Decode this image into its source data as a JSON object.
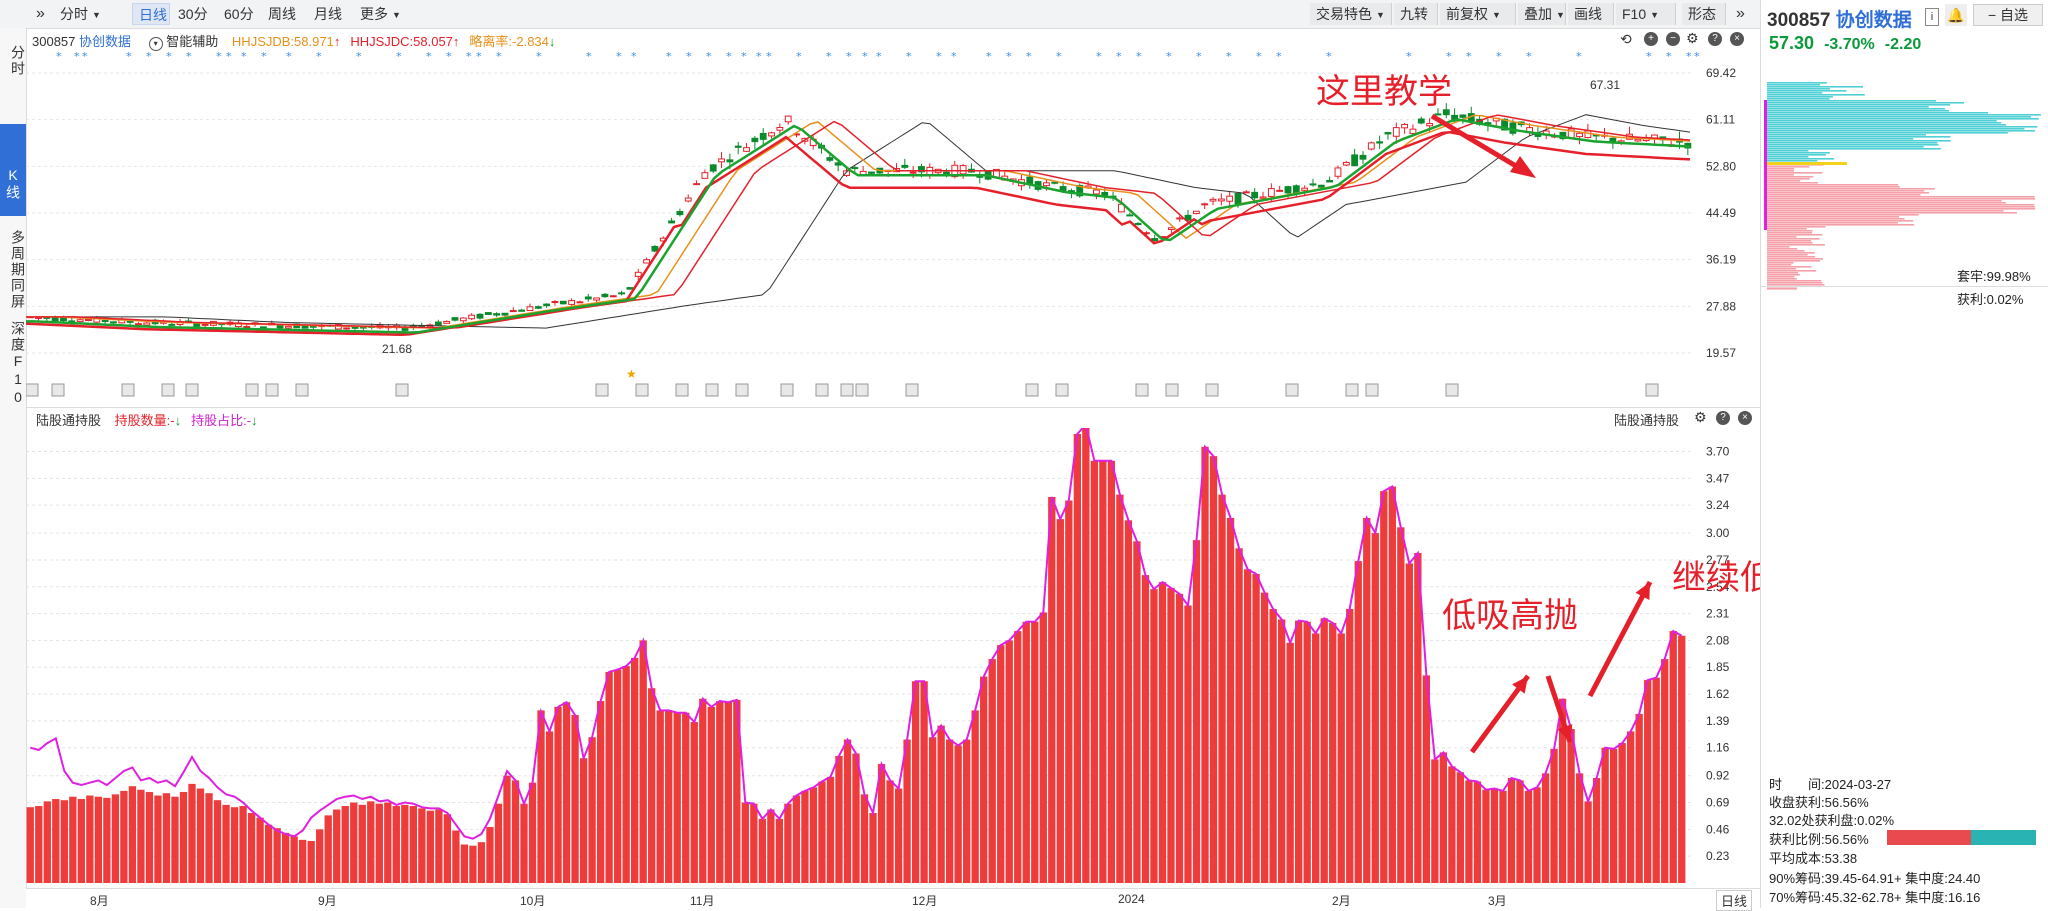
{
  "toolbar": {
    "expand_icon": "double-chevron-right-icon",
    "left_buttons": [
      {
        "label": "分时",
        "caret": true
      },
      {
        "label": "日线",
        "active": true
      },
      {
        "label": "30分"
      },
      {
        "label": "60分"
      },
      {
        "label": "周线"
      },
      {
        "label": "月线"
      },
      {
        "label": "更多",
        "caret": true
      }
    ],
    "right_buttons": [
      {
        "label": "交易特色",
        "caret": true
      },
      {
        "label": "九转"
      },
      {
        "label": "前复权",
        "caret": true
      },
      {
        "label": "叠加",
        "caret": true
      },
      {
        "label": "画线"
      },
      {
        "label": "F10",
        "caret": true
      },
      {
        "label": "形态"
      }
    ]
  },
  "left_nav": [
    {
      "label": "分时"
    },
    {
      "label": "K线",
      "active": true
    },
    {
      "label": "多周期同屏"
    },
    {
      "label": "深度F10"
    }
  ],
  "kline_panel": {
    "code": "300857",
    "name": "协创数据",
    "assist_label": "智能辅助",
    "indicators": [
      {
        "text": "HHJSJDB:58.971",
        "arrow": "↑",
        "color": "#e8901a"
      },
      {
        "text": "HHJSJDC:58.057",
        "arrow": "↑",
        "color": "#e5202a"
      },
      {
        "text": "略离率:-2.834",
        "arrow": "↓",
        "color": "#e8901a"
      }
    ],
    "y_ticks": [
      "69.42",
      "61.11",
      "52.80",
      "44.49",
      "36.19",
      "27.88",
      "19.57"
    ],
    "high_label": "67.31",
    "low_label": "21.68",
    "annotation": "这里教学"
  },
  "hold_panel": {
    "title": "陆股通持股",
    "indicators": [
      {
        "text": "持股数量:-",
        "arrow": "↓",
        "color": "#e5202a"
      },
      {
        "text": "持股占比:-",
        "arrow": "↓",
        "color": "#d020d0"
      }
    ],
    "title_right": "陆股通持股",
    "y_ticks": [
      "3.70",
      "3.47",
      "3.24",
      "3.00",
      "2.77",
      "2.54",
      "2.31",
      "2.08",
      "1.85",
      "1.62",
      "1.39",
      "1.16",
      "0.92",
      "0.69",
      "0.46",
      "0.23"
    ],
    "annotation_1": "低吸高抛",
    "annotation_2": "继续低吸"
  },
  "x_axis": {
    "labels": [
      "8月",
      "9月",
      "10月",
      "11月",
      "12月",
      "2024",
      "2月",
      "3月"
    ],
    "period": "日线"
  },
  "chart_data": {
    "type": "bar",
    "title": "",
    "ylabel": "",
    "ylim": [
      0,
      3.85
    ],
    "values": [
      0.65,
      0.66,
      0.7,
      0.72,
      0.71,
      0.74,
      0.72,
      0.75,
      0.74,
      0.73,
      0.76,
      0.79,
      0.83,
      0.8,
      0.78,
      0.75,
      0.77,
      0.74,
      0.78,
      0.85,
      0.81,
      0.77,
      0.71,
      0.67,
      0.65,
      0.66,
      0.6,
      0.56,
      0.5,
      0.47,
      0.43,
      0.4,
      0.37,
      0.36,
      0.46,
      0.58,
      0.63,
      0.66,
      0.69,
      0.67,
      0.7,
      0.68,
      0.69,
      0.66,
      0.67,
      0.66,
      0.64,
      0.62,
      0.63,
      0.59,
      0.45,
      0.33,
      0.32,
      0.35,
      0.48,
      0.68,
      0.92,
      0.88,
      0.68,
      0.86,
      1.48,
      1.3,
      1.51,
      1.55,
      1.44,
      1.07,
      1.25,
      1.56,
      1.81,
      1.83,
      1.86,
      1.93,
      2.08,
      1.67,
      1.48,
      1.48,
      1.46,
      1.46,
      1.38,
      1.58,
      1.51,
      1.56,
      1.55,
      1.57,
      0.69,
      0.68,
      0.55,
      0.63,
      0.55,
      0.68,
      0.75,
      0.79,
      0.82,
      0.87,
      0.91,
      1.09,
      1.23,
      1.11,
      0.76,
      0.6,
      1.02,
      0.88,
      0.81,
      1.23,
      1.73,
      1.73,
      1.25,
      1.35,
      1.23,
      1.18,
      1.23,
      1.48,
      1.77,
      1.92,
      2.04,
      2.08,
      2.16,
      2.24,
      2.24,
      2.32,
      3.31,
      3.12,
      3.28,
      3.85,
      3.93,
      3.62,
      3.62,
      3.62,
      3.33,
      3.11,
      2.93,
      2.64,
      2.52,
      2.58,
      2.53,
      2.48,
      2.38,
      2.94,
      3.74,
      3.66,
      3.33,
      3.13,
      2.87,
      2.69,
      2.65,
      2.49,
      2.35,
      2.26,
      2.06,
      2.25,
      2.24,
      2.14,
      2.27,
      2.23,
      2.14,
      2.35,
      2.76,
      3.13,
      3.0,
      3.36,
      3.4,
      3.05,
      2.74,
      2.83,
      1.78,
      1.06,
      1.12,
      1.0,
      0.95,
      0.88,
      0.87,
      0.8,
      0.81,
      0.79,
      0.9,
      0.88,
      0.79,
      0.82,
      0.94,
      1.15,
      1.58,
      1.32,
      0.94,
      0.7,
      0.9,
      1.16,
      1.15,
      1.2,
      1.3,
      1.45,
      1.74,
      1.76,
      1.92,
      2.16,
      2.12
    ],
    "line": [
      1.16,
      1.14,
      1.2,
      1.24,
      0.96,
      0.86,
      0.84,
      0.86,
      0.88,
      0.84,
      0.9,
      0.96,
      0.99,
      0.88,
      0.9,
      0.86,
      0.88,
      0.83,
      0.95,
      1.08,
      0.96,
      0.9,
      0.82,
      0.76,
      0.74,
      0.69,
      0.62,
      0.56,
      0.5,
      0.45,
      0.42,
      0.4,
      0.45,
      0.56,
      0.62,
      0.67,
      0.72,
      0.74,
      0.75,
      0.72,
      0.74,
      0.7,
      0.71,
      0.67,
      0.69,
      0.68,
      0.65,
      0.64,
      0.64,
      0.6,
      0.5,
      0.4,
      0.38,
      0.42,
      0.55,
      0.75,
      0.96,
      0.88,
      0.68,
      0.86,
      1.47,
      1.3,
      1.51,
      1.55,
      1.44,
      1.07,
      1.25,
      1.56,
      1.81,
      1.83,
      1.86,
      1.93,
      2.08,
      1.67,
      1.48,
      1.48,
      1.46,
      1.46,
      1.38,
      1.58,
      1.51,
      1.56,
      1.55,
      1.57,
      0.69,
      0.68,
      0.55,
      0.63,
      0.55,
      0.68,
      0.75,
      0.79,
      0.82,
      0.87,
      0.91,
      1.09,
      1.23,
      1.11,
      0.76,
      0.6,
      1.02,
      0.88,
      0.81,
      1.23,
      1.73,
      1.73,
      1.25,
      1.35,
      1.23,
      1.18,
      1.23,
      1.48,
      1.77,
      1.92,
      2.04,
      2.08,
      2.16,
      2.24,
      2.24,
      2.32,
      3.31,
      3.12,
      3.28,
      3.85,
      3.93,
      3.62,
      3.62,
      3.62,
      3.33,
      3.11,
      2.93,
      2.64,
      2.52,
      2.58,
      2.53,
      2.48,
      2.38,
      2.94,
      3.74,
      3.66,
      3.33,
      3.13,
      2.87,
      2.69,
      2.65,
      2.49,
      2.35,
      2.26,
      2.06,
      2.25,
      2.24,
      2.14,
      2.27,
      2.23,
      2.14,
      2.35,
      2.76,
      3.13,
      3.0,
      3.36,
      3.4,
      3.05,
      2.74,
      2.83,
      1.78,
      1.06,
      1.12,
      1.0,
      0.95,
      0.88,
      0.87,
      0.8,
      0.81,
      0.79,
      0.9,
      0.88,
      0.79,
      0.82,
      0.94,
      1.15,
      1.58,
      1.32,
      0.94,
      0.7,
      0.9,
      1.16,
      1.15,
      1.2,
      1.3,
      1.45,
      1.74,
      1.76,
      1.92,
      2.16,
      2.12
    ]
  },
  "right_panel": {
    "code": "300857",
    "name": "协创数据",
    "watch_label": "自选",
    "price": "57.30",
    "change_pct": "-3.70%",
    "change": "-2.20",
    "locked_label": "套牢:99.98%",
    "profit_label": "获利:0.02%",
    "date_line": "时　　间:2024-03-27",
    "close_profit": "收盘获利:56.56%",
    "point_profit": "32.02处获利盘:0.02%",
    "profit_ratio": "获利比例:56.56%",
    "avg_cost": "平均成本:53.38",
    "chip_90": "90%筹码:39.45-64.91+ 集中度:24.40",
    "chip_70": "70%筹码:45.32-62.78+ 集中度:16.16",
    "colors": {
      "down": "#0a9a3c",
      "up": "#e5202a",
      "profit_bar": "#e84a50",
      "locked_bar": "#2ab3b3"
    }
  }
}
